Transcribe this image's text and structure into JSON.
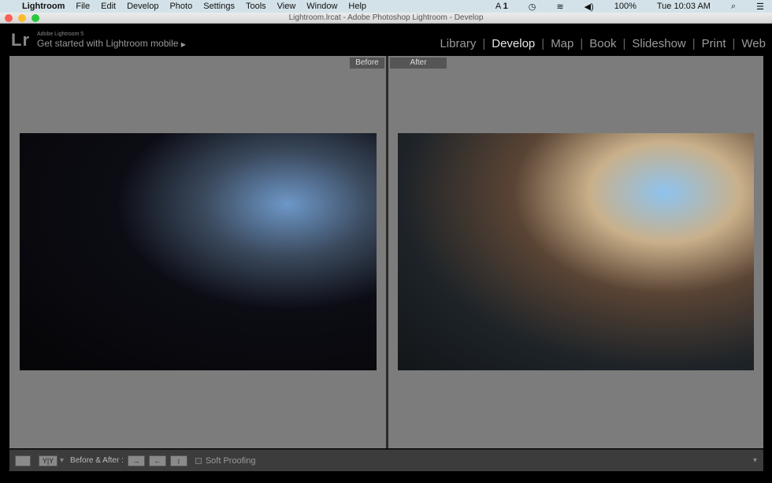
{
  "menubar": {
    "app": "Lightroom",
    "items": [
      "File",
      "Edit",
      "Develop",
      "Photo",
      "Settings",
      "Tools",
      "View",
      "Window",
      "Help"
    ],
    "status": {
      "adobe": "1",
      "battery": "100%",
      "clock": "Tue 10:03 AM"
    }
  },
  "window": {
    "title": "Lightroom.lrcat - Adobe Photoshop Lightroom - Develop"
  },
  "header": {
    "logo": "Lr",
    "product": "Adobe Lightroom 5",
    "mobile": "Get started with Lightroom mobile",
    "modules": [
      "Library",
      "Develop",
      "Map",
      "Book",
      "Slideshow",
      "Print",
      "Web"
    ],
    "active": "Develop"
  },
  "view": {
    "before_label": "Before",
    "after_label": "After"
  },
  "toolbar": {
    "ba_label": "Before & After :",
    "soft_proofing": "Soft Proofing",
    "yy": "Y|Y"
  }
}
